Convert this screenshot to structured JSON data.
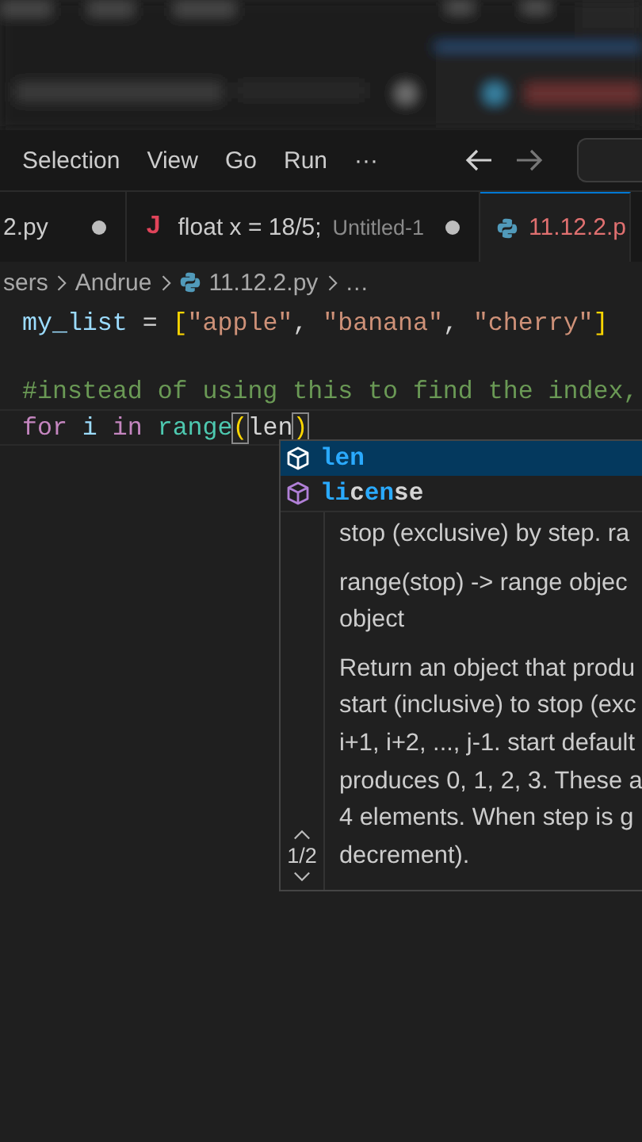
{
  "menu": [
    {
      "label": "Selection"
    },
    {
      "label": "View"
    },
    {
      "label": "Go"
    },
    {
      "label": "Run"
    },
    {
      "label": "···"
    }
  ],
  "tabs": [
    {
      "label": "2.py",
      "kind": "plain",
      "dirty": true,
      "selected": false
    },
    {
      "label": "float x = 18/5;",
      "description": "Untitled-1",
      "kind": "letter",
      "icon_text": "J",
      "dirty": true,
      "selected": false
    },
    {
      "label": "11.12.2.p",
      "kind": "python",
      "selected": true
    }
  ],
  "breadcrumb": [
    {
      "label": "sers",
      "kind": "folder"
    },
    {
      "label": "Andrue",
      "kind": "folder"
    },
    {
      "label": "11.12.2.py",
      "kind": "python"
    },
    {
      "label": "…",
      "kind": "more"
    }
  ],
  "code_lines": [
    {
      "kind": "code",
      "tokens": [
        {
          "text": "my_list",
          "kind": "variable"
        },
        {
          "text": " = ",
          "kind": "plain"
        },
        {
          "text": "[",
          "kind": "bracket"
        },
        {
          "text": "\"apple\"",
          "kind": "string"
        },
        {
          "text": ", ",
          "kind": "plain"
        },
        {
          "text": "\"banana\"",
          "kind": "string"
        },
        {
          "text": ", ",
          "kind": "plain"
        },
        {
          "text": "\"cherry\"",
          "kind": "string"
        },
        {
          "text": "]",
          "kind": "bracket"
        }
      ]
    },
    {
      "kind": "blank"
    },
    {
      "kind": "code",
      "tokens": [
        {
          "text": "#instead of using this to find the index,",
          "kind": "comment"
        }
      ]
    },
    {
      "kind": "current",
      "tokens": [
        {
          "text": "for ",
          "kind": "keyword"
        },
        {
          "text": "i ",
          "kind": "variable"
        },
        {
          "text": "in ",
          "kind": "keyword"
        },
        {
          "text": "range",
          "kind": "function"
        },
        {
          "text": "(",
          "kind": "matched-bracket"
        },
        {
          "text": "len",
          "kind": "plain"
        },
        {
          "text": ")",
          "kind": "matched-bracket"
        }
      ]
    }
  ],
  "suggestions": [
    {
      "kind": "function",
      "selected": true,
      "parts": [
        {
          "text": "len",
          "match": true
        }
      ]
    },
    {
      "kind": "function",
      "selected": false,
      "parts": [
        {
          "text": "li",
          "match": true
        },
        {
          "text": "c",
          "match": false
        },
        {
          "text": "en",
          "match": true
        },
        {
          "text": "se",
          "match": false
        }
      ]
    }
  ],
  "docs": {
    "paragraphs": [
      [
        "stop (exclusive) by step. ra"
      ],
      [
        "range(stop) -> range objec",
        "object"
      ],
      [
        "Return an object that produ",
        "start (inclusive) to stop (exc",
        "i+1, i+2, ..., j-1. start default",
        "produces 0, 1, 2, 3. These a",
        "4 elements. When step is g",
        "decrement)."
      ]
    ],
    "page": "1/2"
  }
}
